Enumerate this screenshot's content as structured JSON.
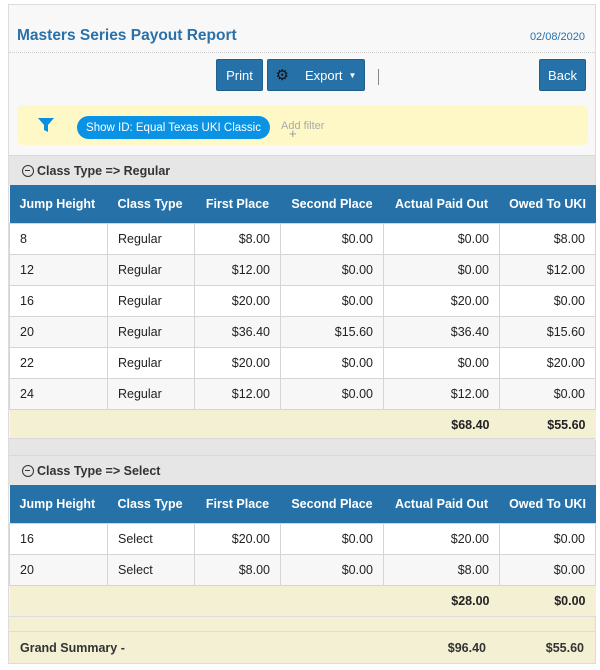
{
  "header": {
    "title": "Masters Series Payout Report",
    "date": "02/08/2020"
  },
  "toolbar": {
    "print_label": "Print",
    "export_label": "Export",
    "back_label": "Back"
  },
  "filter": {
    "chip_label": "Show ID: Equal Texas UKI Classic",
    "add_filter_label": "Add filter"
  },
  "columns": [
    "Jump Height",
    "Class Type",
    "First Place",
    "Second Place",
    "Actual Paid Out",
    "Owed To UKI"
  ],
  "groups": [
    {
      "header": "Class Type => Regular",
      "rows": [
        [
          "8",
          "Regular",
          "$8.00",
          "$0.00",
          "$0.00",
          "$8.00"
        ],
        [
          "12",
          "Regular",
          "$12.00",
          "$0.00",
          "$0.00",
          "$12.00"
        ],
        [
          "16",
          "Regular",
          "$20.00",
          "$0.00",
          "$20.00",
          "$0.00"
        ],
        [
          "20",
          "Regular",
          "$36.40",
          "$15.60",
          "$36.40",
          "$15.60"
        ],
        [
          "22",
          "Regular",
          "$20.00",
          "$0.00",
          "$0.00",
          "$20.00"
        ],
        [
          "24",
          "Regular",
          "$12.00",
          "$0.00",
          "$12.00",
          "$0.00"
        ]
      ],
      "summary": {
        "actual_paid_out": "$68.40",
        "owed_to_uki": "$55.60"
      }
    },
    {
      "header": "Class Type => Select",
      "rows": [
        [
          "16",
          "Select",
          "$20.00",
          "$0.00",
          "$20.00",
          "$0.00"
        ],
        [
          "20",
          "Select",
          "$8.00",
          "$0.00",
          "$8.00",
          "$0.00"
        ]
      ],
      "summary": {
        "actual_paid_out": "$28.00",
        "owed_to_uki": "$0.00"
      }
    }
  ],
  "grand_summary": {
    "label": "Grand Summary -",
    "actual_paid_out": "$96.40",
    "owed_to_uki": "$55.60"
  },
  "colors": {
    "accent": "#2672a8",
    "title": "#2a71a9",
    "filter_bg": "#fdf8c5",
    "chip": "#0a93e4",
    "summary_bg": "#f4f0d4"
  }
}
